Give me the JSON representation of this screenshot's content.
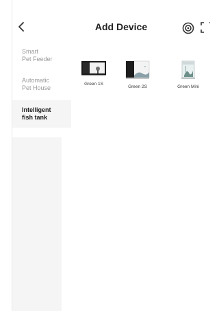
{
  "header": {
    "title": "Add Device"
  },
  "icons": {
    "back": "chevron-left-icon",
    "target": "target-icon",
    "scan": "scan-icon"
  },
  "sidebar": {
    "items": [
      {
        "label": "Smart\nPet Feeder",
        "active": false
      },
      {
        "label": "Automatic\nPet House",
        "active": false
      },
      {
        "label": "Intelligent\nfish tank",
        "active": true
      }
    ]
  },
  "devices": [
    {
      "label": "Green 1S",
      "icon": "fish-tank-thumbnail-icon"
    },
    {
      "label": "Green 2S",
      "icon": "fish-tank-thumbnail-icon"
    },
    {
      "label": "Green Mini",
      "icon": "fish-tank-thumbnail-icon"
    }
  ],
  "colors": {
    "sidebar_active_bg": "#f5f5f5",
    "text_dark": "#222222",
    "text_muted": "#9a9a9a"
  }
}
